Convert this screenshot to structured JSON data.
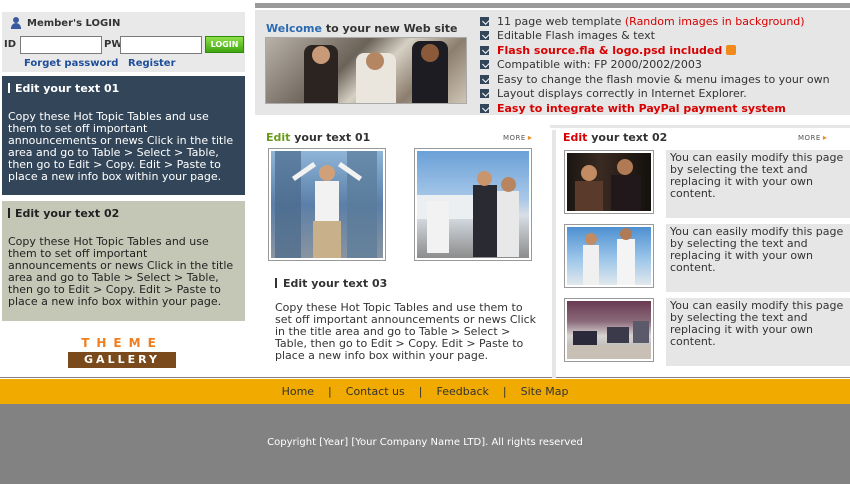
{
  "login": {
    "title": "Member's LOGIN",
    "id_label": "ID",
    "pw_label": "PW",
    "id_value": "",
    "pw_value": "",
    "button": "LOGIN",
    "forget": "Forget password",
    "register": "Register"
  },
  "sidebar": {
    "box1_title": "Edit your text 01",
    "box1_text": "Copy these Hot Topic Tables and use them to set off important announcements or news Click in the title area and go to Table > Select > Table, then go to Edit > Copy. Edit > Paste to place a new info box within your page.",
    "box2_title": "Edit your text 02",
    "box2_text": "Copy these Hot Topic Tables and use them to set off important announcements or news Click in the title area and go to Table > Select > Table, then go to Edit > Copy. Edit > Paste to place a new info box within your page."
  },
  "logo": {
    "top": "THEME",
    "bottom": "GALLERY"
  },
  "welcome": {
    "title_highlight": "Welcome",
    "title_rest": "to your new Web site"
  },
  "features": [
    {
      "text": "11 page web template",
      "extra": "(Random images in background)"
    },
    {
      "text": "Editable Flash images & text"
    },
    {
      "text": "Flash source.fla & logo.psd included"
    },
    {
      "text": "Compatible with: FP 2000/2002/2003"
    },
    {
      "text": "Easy to change the flash movie & menu images to your own"
    },
    {
      "text": "Layout displays correctly in Internet Explorer."
    },
    {
      "text": "Easy to integrate with PayPal payment system"
    }
  ],
  "middle": {
    "title_highlight": "Edit",
    "title_rest": "your text 01",
    "more": "MORE",
    "sub_title": "Edit your text 03",
    "sub_text": "Copy these Hot Topic Tables and use them to set off important announcements or news Click in the title area and go to Table > Select > Table, then go to Edit > Copy. Edit > Paste to place a new info box within your page."
  },
  "right": {
    "title_highlight": "Edit",
    "title_rest": "your text 02",
    "more": "MORE",
    "items": [
      {
        "text": "You can easily modify this page by selecting the text and replacing it with your own content."
      },
      {
        "text": "You can easily modify this page by selecting the text and replacing it with your own content."
      },
      {
        "text": "You can easily modify this page by selecting the text and replacing it with your own content."
      }
    ]
  },
  "nav": [
    "Home",
    "Contact us",
    "Feedback",
    "Site Map"
  ],
  "copyright": "Copyright   [Year] [Your Company Name LTD]. All rights reserved",
  "colors": {
    "accent_orange": "#f0aa00",
    "dark_box": "#334659",
    "light_box": "#c5c7b6",
    "red": "#d80000"
  }
}
